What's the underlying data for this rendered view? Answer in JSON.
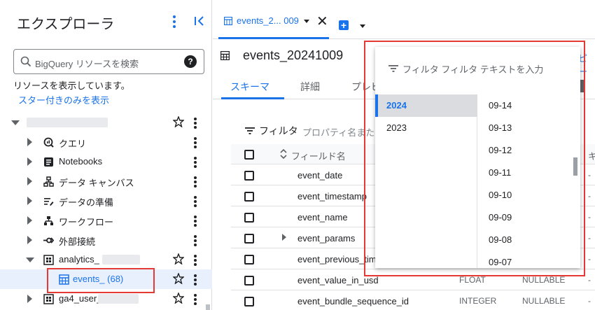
{
  "explorer": {
    "title": "エクスプローラ",
    "search_placeholder": "BigQuery リソースを検索",
    "status": "リソースを表示しています。",
    "starred_link": "スター付きのみを表示",
    "items": [
      {
        "label": "",
        "icon": "none"
      },
      {
        "label": "クエリ",
        "icon": "query-icon"
      },
      {
        "label": "Notebooks",
        "icon": "notebook-icon"
      },
      {
        "label": "データ キャンバス",
        "icon": "canvas-icon"
      },
      {
        "label": "データの準備",
        "icon": "data-prep-icon"
      },
      {
        "label": "ワークフロー",
        "icon": "workflow-icon"
      },
      {
        "label": "外部接続",
        "icon": "connection-icon"
      },
      {
        "label": "analytics_",
        "icon": "dataset-icon"
      },
      {
        "label": "events_ (68)",
        "icon": "table-icon"
      },
      {
        "label": "ga4_user_",
        "icon": "dataset-icon"
      }
    ]
  },
  "tabbar": {
    "tab_label": "events_2... 009"
  },
  "detail": {
    "title": "events_20241009",
    "share_link": "ピー",
    "subtabs": [
      "スキーマ",
      "詳細",
      "プレビ"
    ]
  },
  "schema": {
    "filter_label": "フィルタ",
    "filter_placeholder": "プロパティ名また",
    "header_field": "フィールド名",
    "header_k": "キ",
    "rows": [
      {
        "name": "event_date",
        "type": "",
        "mode": "",
        "dash": "-"
      },
      {
        "name": "event_timestamp",
        "type": "",
        "mode": "",
        "dash": "-"
      },
      {
        "name": "event_name",
        "type": "",
        "mode": "",
        "dash": "-"
      },
      {
        "name": "event_params",
        "type": "",
        "mode": "",
        "dash": "-",
        "expandable": true
      },
      {
        "name": "event_previous_tim",
        "type": "",
        "mode": "",
        "dash": "-"
      },
      {
        "name": "event_value_in_usd",
        "type": "FLOAT",
        "mode": "NULLABLE",
        "dash": "-"
      },
      {
        "name": "event_bundle_sequence_id",
        "type": "INTEGER",
        "mode": "NULLABLE",
        "dash": "-"
      }
    ]
  },
  "popup": {
    "filter_text": "フィルタ フィルタ テキストを入力",
    "years": [
      "2024",
      "2023"
    ],
    "selected_year": "2024",
    "dates": [
      "09-14",
      "09-13",
      "09-12",
      "09-11",
      "09-10",
      "09-09",
      "09-08",
      "09-07"
    ]
  },
  "colors": {
    "accent": "#1a73e8",
    "highlight": "#e53935"
  }
}
